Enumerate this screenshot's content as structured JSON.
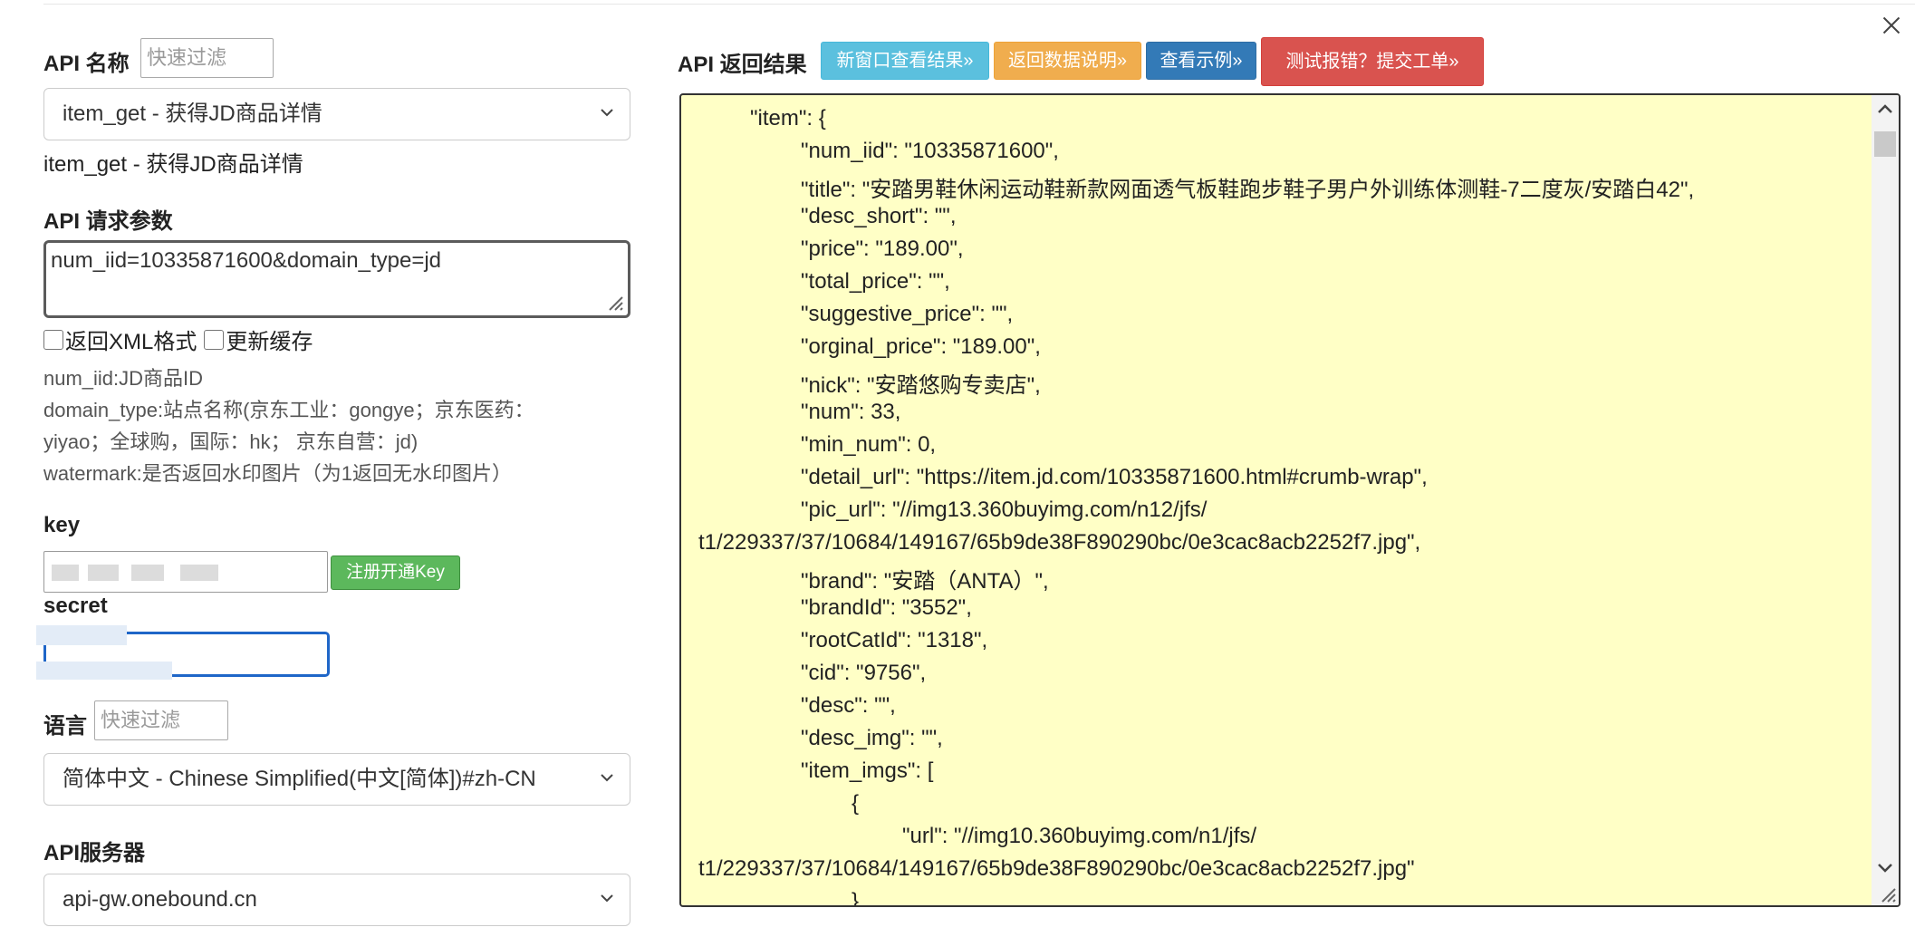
{
  "left_panel": {
    "api_name": {
      "label": "API 名称",
      "filter_placeholder": "快速过滤",
      "selected": "item_get - 获得JD商品详情",
      "caption": "item_get - 获得JD商品详情"
    },
    "request_params": {
      "label": "API 请求参数",
      "value": "num_iid=10335871600&domain_type=jd"
    },
    "options": {
      "return_xml": "返回XML格式",
      "refresh_cache": "更新缓存"
    },
    "param_desc": [
      "num_iid:JD商品ID",
      "domain_type:站点名称(京东工业：gongye；京东医药：",
      "yiyao；全球购，国际：hk； 京东自营：jd)",
      "watermark:是否返回水印图片（为1返回无水印图片）"
    ],
    "key": {
      "label": "key",
      "register_button": "注册开通Key"
    },
    "secret": {
      "label": "secret"
    },
    "language": {
      "label": "语言",
      "filter_placeholder": "快速过滤",
      "selected": "简体中文 - Chinese Simplified(中文[简体])#zh-CN"
    },
    "server": {
      "label": "API服务器",
      "selected": "api-gw.onebound.cn"
    }
  },
  "right_panel": {
    "title": "API 返回结果",
    "buttons": {
      "new_window": "新窗口查看结果»",
      "data_doc": "返回数据说明»",
      "examples": "查看示例»",
      "report": "测试报错？提交工单»"
    },
    "json_lines": [
      "\"item\": {",
      "\"num_iid\": \"10335871600\",",
      "\"title\": \"安踏男鞋休闲运动鞋新款网面透气板鞋跑步鞋子男户外训练体测鞋-7二度灰/安踏白42\",",
      "\"desc_short\": \"\",",
      "\"price\": \"189.00\",",
      "\"total_price\": \"\",",
      "\"suggestive_price\": \"\",",
      "\"orginal_price\": \"189.00\",",
      "\"nick\": \"安踏悠购专卖店\",",
      "\"num\": 33,",
      "\"min_num\": 0,",
      "\"detail_url\": \"https://item.jd.com/10335871600.html#crumb-wrap\",",
      "\"pic_url\": \"//img13.360buyimg.com/n12/jfs/",
      "t1/229337/37/10684/149167/65b9de38F890290bc/0e3cac8acb2252f7.jpg\",",
      "\"brand\": \"安踏（ANTA）\",",
      "\"brandId\": \"3552\",",
      "\"rootCatId\": \"1318\",",
      "\"cid\": \"9756\",",
      "\"desc\": \"\",",
      "\"desc_img\": \"\",",
      "\"item_imgs\": [",
      "{",
      "\"url\": \"//img10.360buyimg.com/n1/jfs/",
      "t1/229337/37/10684/149167/65b9de38F890290bc/0e3cac8acb2252f7.jpg\"",
      "},"
    ]
  },
  "colors": {
    "new_window_btn": "#5bc0de",
    "data_doc_btn": "#f0ad4e",
    "examples_btn": "#337ab7",
    "report_btn": "#d9534f",
    "register_btn": "#5cb85c",
    "result_bg": "#ffffc6",
    "secret_focus": "#1f66c8"
  },
  "icons": [
    "close-icon",
    "chevron-down-icon",
    "resize-grip-icon",
    "scroll-up-icon",
    "scroll-down-icon"
  ]
}
